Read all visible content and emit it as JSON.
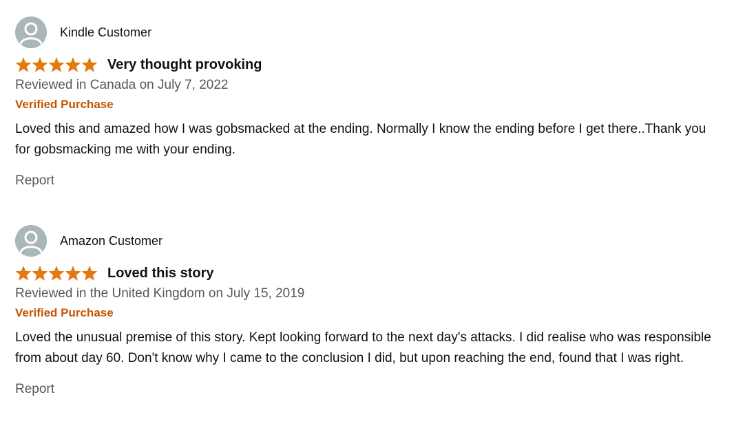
{
  "icons": {
    "avatar": "person-silhouette-icon",
    "star": "star-filled-icon"
  },
  "colors": {
    "star": "#e47911",
    "verified": "#c45500",
    "avatar_bg": "#aab7b8",
    "muted_text": "#565959"
  },
  "reviews": [
    {
      "author": "Kindle Customer",
      "rating": 5,
      "title": "Very thought provoking",
      "date": "Reviewed in Canada on July 7, 2022",
      "badge": "Verified Purchase",
      "body": "Loved this and amazed how I was gobsmacked at the ending. Normally I know the ending before I get there..Thank you for gobsmacking me with your ending.",
      "report_label": "Report"
    },
    {
      "author": "Amazon Customer",
      "rating": 5,
      "title": "Loved this story",
      "date": "Reviewed in the United Kingdom on July 15, 2019",
      "badge": "Verified Purchase",
      "body": "Loved the unusual premise of this story. Kept looking forward to the next day's attacks. I did realise who was responsible from about day 60. Don't know why I came to the conclusion I did, but upon reaching the end, found that I was right.",
      "report_label": "Report"
    }
  ]
}
